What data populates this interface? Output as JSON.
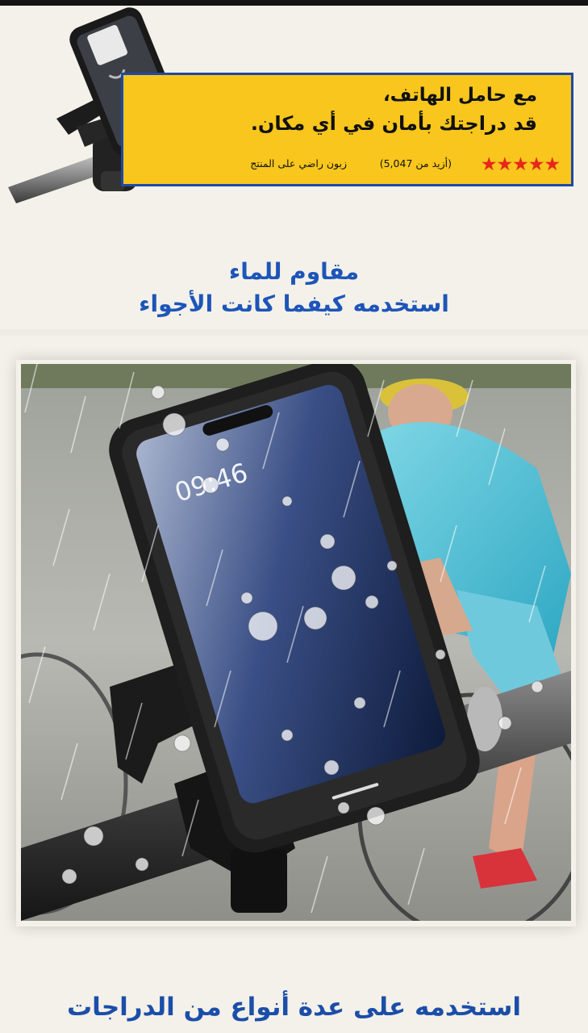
{
  "banner": {
    "line1": "مع حامل الهاتف،",
    "line2": "قد دراجتك بأمان في أي مكان.",
    "stars": "★★★★★",
    "rating_count": "(أزيد من 5,047)",
    "rating_label": "زبون راضي على المنتج",
    "colors": {
      "background": "#f8c61c",
      "border": "#1d4aa8",
      "stars": "#e8261c"
    }
  },
  "section_waterproof": {
    "title": "مقاوم للماء",
    "subtitle": "استخدمه كيفما كانت الأجواء"
  },
  "product_photo": {
    "screen_time": "09:46"
  },
  "section_bikes": {
    "title": "استخدمه على عدة أنواع من الدراجات"
  },
  "colors": {
    "heading": "#1d55b8",
    "page_background": "#f4f1ea"
  }
}
